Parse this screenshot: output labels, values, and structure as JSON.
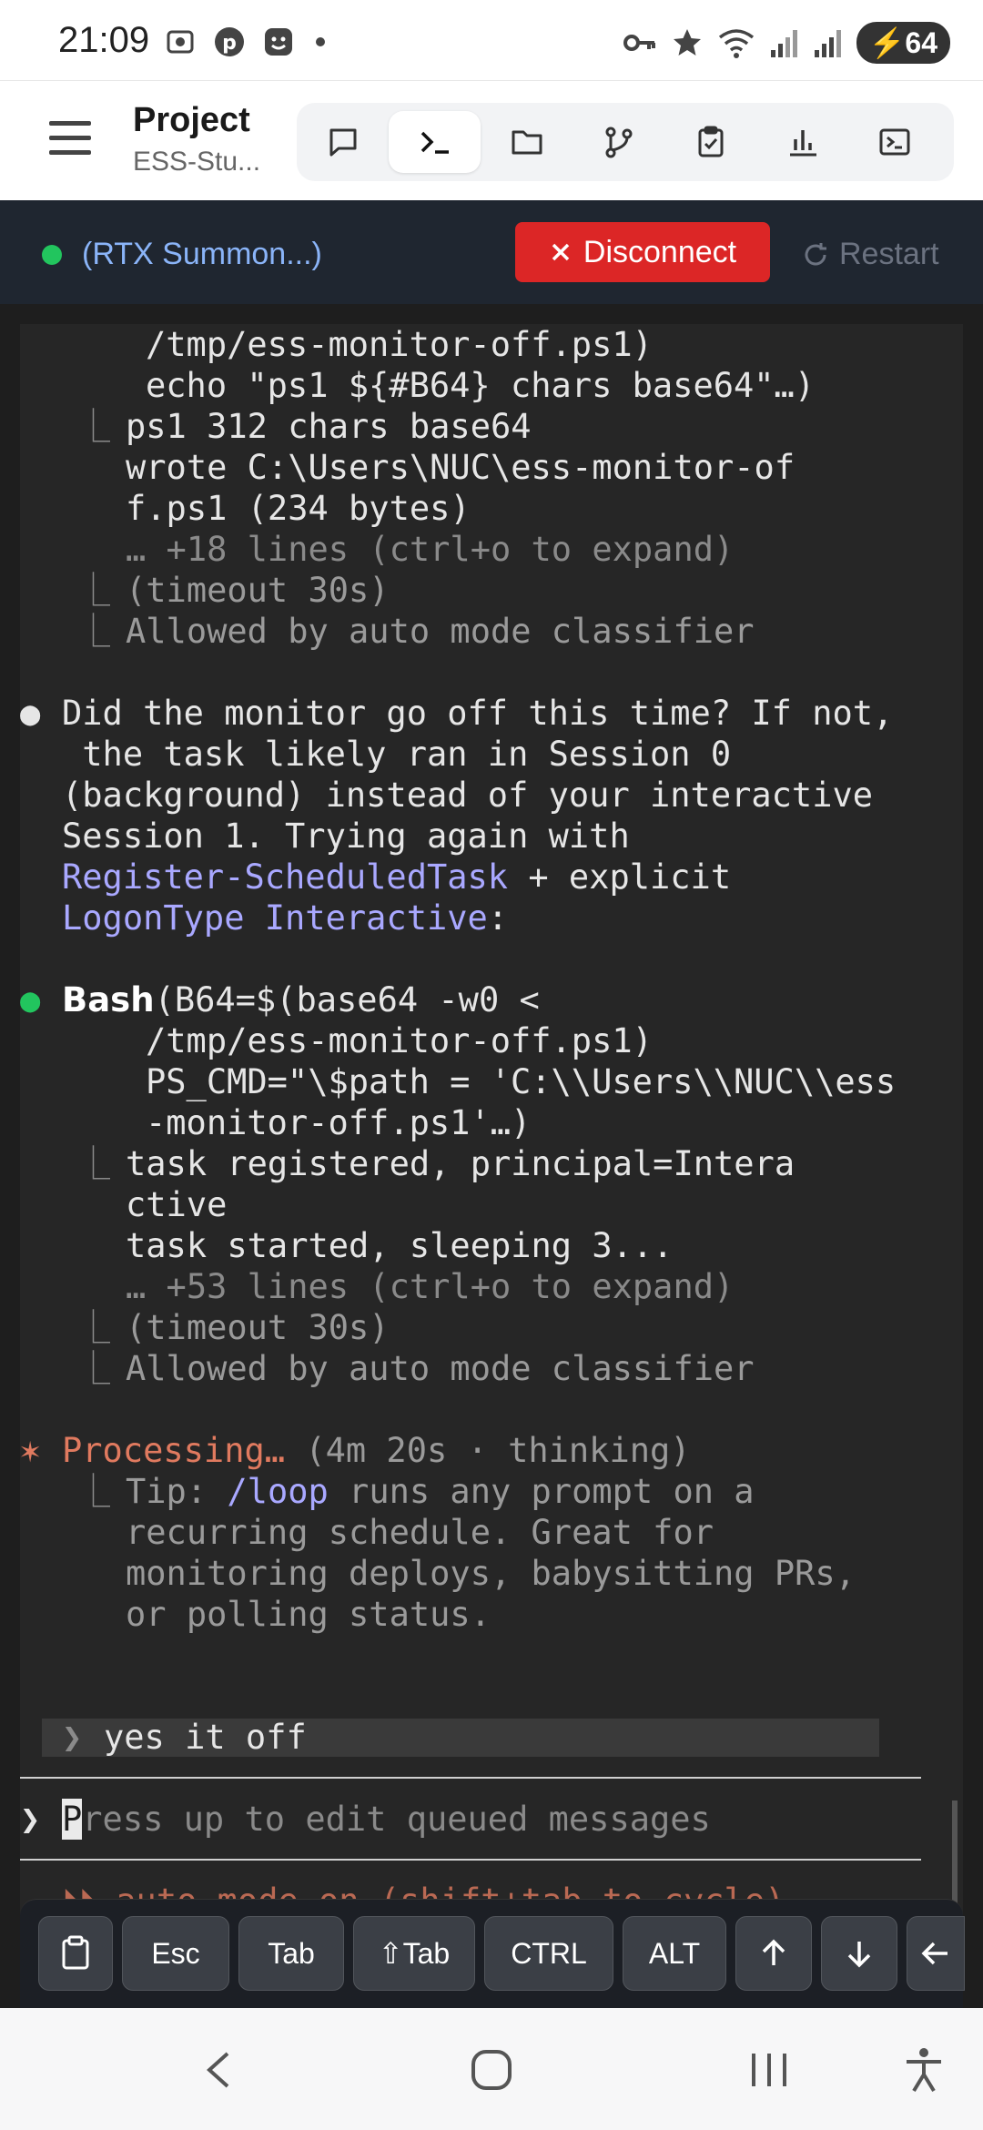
{
  "status_bar": {
    "time": "21:09",
    "battery": "64",
    "left_icons": [
      "screenshot-icon",
      "pinterest-icon",
      "face-icon",
      "dot-icon"
    ],
    "right_icons": [
      "key-icon",
      "star-icon",
      "wifi-icon",
      "signal-icon",
      "signal-icon-2",
      "battery-icon"
    ]
  },
  "header": {
    "title": "Project",
    "subtitle": "ESS-Stu...",
    "tabs": [
      {
        "icon": "chat-icon",
        "active": false
      },
      {
        "icon": "terminal-prompt-icon",
        "active": true
      },
      {
        "icon": "folder-icon",
        "active": false
      },
      {
        "icon": "git-branch-icon",
        "active": false
      },
      {
        "icon": "clipboard-check-icon",
        "active": false
      },
      {
        "icon": "bar-chart-icon",
        "active": false
      },
      {
        "icon": "terminal-window-icon",
        "active": false
      }
    ]
  },
  "connection": {
    "name": "(RTX Summon...)",
    "status_color": "#22c55e",
    "disconnect_label": "Disconnect",
    "restart_label": "Restart"
  },
  "terminal": {
    "l1": "/tmp/ess-monitor-off.ps1)",
    "l2": "echo \"ps1 ${#B64} chars base64\"…)",
    "l3": "ps1 312 chars base64",
    "l4": "wrote C:\\Users\\NUC\\ess-monitor-of",
    "l5": "f.ps1 (234 bytes)",
    "l6": "… +18 lines (ctrl+o to expand)",
    "l7": "(timeout 30s)",
    "l8": "Allowed by auto mode classifier",
    "m1": "Did the monitor go off this time? If not,",
    "m2": " the task likely ran in Session 0",
    "m3": "(background) instead of your interactive",
    "m4": "Session 1. Trying again with",
    "m5a": "Register-ScheduledTask",
    "m5b": " + explicit",
    "m6a": "LogonType Interactive",
    "m6b": ":",
    "b_name": "Bash",
    "b1": "(B64=$(base64 -w0 <",
    "b2": "/tmp/ess-monitor-off.ps1)",
    "b3": "PS_CMD=\"\\$path = 'C:\\\\Users\\\\NUC\\\\ess",
    "b4": "-monitor-off.ps1'…)",
    "r1": "task registered, principal=Intera",
    "r2": "ctive",
    "r3": "task started, sleeping 3...",
    "r4": "… +53 lines (ctrl+o to expand)",
    "r5": "(timeout 30s)",
    "r6": "Allowed by auto mode classifier",
    "p_word": "Processing…",
    "p_rest": " (4m 20s · thinking)",
    "t1a": "Tip: ",
    "t1b": "/loop",
    "t1c": " runs any prompt on a",
    "t2": "recurring schedule. Great for",
    "t3": "monitoring deploys, babysitting PRs,",
    "t4": "or polling status.",
    "queued": "yes it off",
    "input_first": "P",
    "input_rest": "ress up to edit queued messages",
    "footer_partial": "⏵⏵ auto mode on (shift+tab to cycle)"
  },
  "keys": [
    "Esc",
    "Tab",
    "⇧Tab",
    "CTRL",
    "ALT"
  ]
}
